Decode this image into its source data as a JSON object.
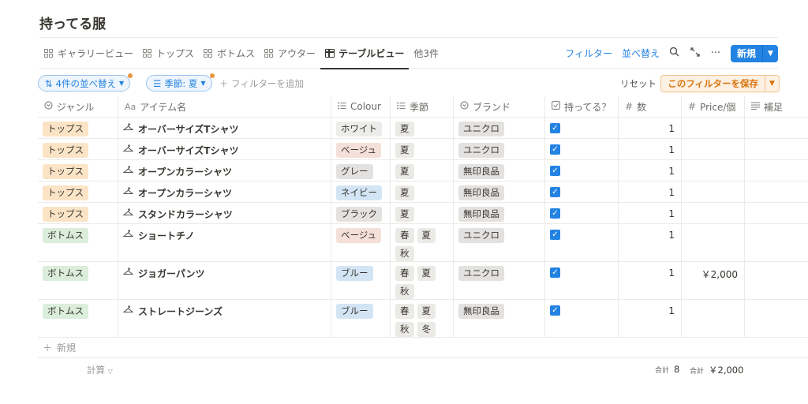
{
  "page": {
    "title": "持ってる服"
  },
  "tabs": [
    {
      "label": "ギャラリービュー",
      "icon": "gallery-icon",
      "active": false
    },
    {
      "label": "トップス",
      "icon": "gallery-icon",
      "active": false
    },
    {
      "label": "ボトムス",
      "icon": "gallery-icon",
      "active": false
    },
    {
      "label": "アウター",
      "icon": "gallery-icon",
      "active": false
    },
    {
      "label": "テーブルビュー",
      "icon": "table-icon",
      "active": true
    }
  ],
  "tabs_more": "他3件",
  "view_actions": {
    "filter": "フィルター",
    "sort": "並べ替え",
    "new": "新規"
  },
  "filter_bar": {
    "sort_chip": "4件の並べ替え",
    "season_chip": "季節: 夏",
    "add_filter": "フィルターを追加",
    "reset": "リセット",
    "save": "このフィルターを保存"
  },
  "columns": [
    {
      "key": "genre",
      "label": "ジャンル",
      "icon": "select-icon"
    },
    {
      "key": "name",
      "label": "アイテム名",
      "icon": "title-icon"
    },
    {
      "key": "colour",
      "label": "Colour",
      "icon": "multi-select-icon"
    },
    {
      "key": "season",
      "label": "季節",
      "icon": "multi-select-icon"
    },
    {
      "key": "brand",
      "label": "ブランド",
      "icon": "select-icon"
    },
    {
      "key": "owned",
      "label": "持ってる？",
      "icon": "checkbox-icon"
    },
    {
      "key": "count",
      "label": "数",
      "icon": "number-icon"
    },
    {
      "key": "price",
      "label": "Price/個",
      "icon": "number-icon"
    },
    {
      "key": "note",
      "label": "補足",
      "icon": "text-icon"
    }
  ],
  "rows": [
    {
      "genre": "トップス",
      "name": "オーバーサイズTシャツ",
      "colour": "ホワイト",
      "season": [
        "夏"
      ],
      "brand": "ユニクロ",
      "owned": true,
      "count": "1",
      "price": ""
    },
    {
      "genre": "トップス",
      "name": "オーバーサイズTシャツ",
      "colour": "ベージュ",
      "season": [
        "夏"
      ],
      "brand": "ユニクロ",
      "owned": true,
      "count": "1",
      "price": ""
    },
    {
      "genre": "トップス",
      "name": "オープンカラーシャツ",
      "colour": "グレー",
      "season": [
        "夏"
      ],
      "brand": "無印良品",
      "owned": true,
      "count": "1",
      "price": ""
    },
    {
      "genre": "トップス",
      "name": "オープンカラーシャツ",
      "colour": "ネイビー",
      "season": [
        "夏"
      ],
      "brand": "無印良品",
      "owned": true,
      "count": "1",
      "price": ""
    },
    {
      "genre": "トップス",
      "name": "スタンドカラーシャツ",
      "colour": "ブラック",
      "season": [
        "夏"
      ],
      "brand": "無印良品",
      "owned": true,
      "count": "1",
      "price": ""
    },
    {
      "genre": "ボトムス",
      "name": "ショートチノ",
      "colour": "ベージュ",
      "season": [
        "春",
        "夏",
        "秋"
      ],
      "brand": "ユニクロ",
      "owned": true,
      "count": "1",
      "price": ""
    },
    {
      "genre": "ボトムス",
      "name": "ジョガーパンツ",
      "colour": "ブルー",
      "season": [
        "春",
        "夏",
        "秋"
      ],
      "brand": "ユニクロ",
      "owned": true,
      "count": "1",
      "price": "￥2,000"
    },
    {
      "genre": "ボトムス",
      "name": "ストレートジーンズ",
      "colour": "ブルー",
      "season": [
        "春",
        "夏",
        "秋",
        "冬"
      ],
      "brand": "無印良品",
      "owned": true,
      "count": "1",
      "price": ""
    }
  ],
  "add_row": "新規",
  "calc": {
    "label": "計算",
    "count_prefix": "合計",
    "count_total": "8",
    "price_prefix": "合計",
    "price_total": "￥2,000"
  },
  "colors": {
    "accent": "#2383e2",
    "genre": {
      "トップス": "#fbe4c6",
      "ボトムス": "#dbeddb"
    },
    "colour": {
      "ホワイト": "#ececea",
      "ベージュ": "#f4e0d8",
      "グレー": "#e3e2e0",
      "ネイビー": "#d3e5f4",
      "ブラック": "#e3e2e0",
      "ブルー": "#d3e5f4"
    },
    "season": "#ebeae7",
    "brand": "#e3e2e0"
  }
}
